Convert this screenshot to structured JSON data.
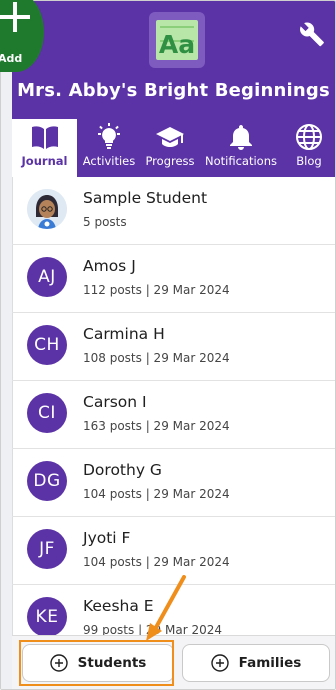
{
  "header": {
    "school_name": "Mrs. Abby's Bright Beginnings",
    "logo_text": "Aa",
    "add_label": "Add"
  },
  "tabs": [
    {
      "label": "Journal",
      "icon": "book-icon",
      "active": true
    },
    {
      "label": "Activities",
      "icon": "lightbulb-icon",
      "active": false
    },
    {
      "label": "Progress",
      "icon": "graduation-cap-icon",
      "active": false
    },
    {
      "label": "Notifications",
      "icon": "bell-icon",
      "active": false
    },
    {
      "label": "Blog",
      "icon": "globe-icon",
      "active": false
    }
  ],
  "students": [
    {
      "name": "Sample Student",
      "initials": "",
      "meta": "5 posts"
    },
    {
      "name": "Amos J",
      "initials": "AJ",
      "meta": "112 posts | 29 Mar 2024"
    },
    {
      "name": "Carmina H",
      "initials": "CH",
      "meta": "108 posts | 29 Mar 2024"
    },
    {
      "name": "Carson I",
      "initials": "CI",
      "meta": "163 posts | 29 Mar 2024"
    },
    {
      "name": "Dorothy G",
      "initials": "DG",
      "meta": "104 posts | 29 Mar 2024"
    },
    {
      "name": "Jyoti F",
      "initials": "JF",
      "meta": "104 posts | 29 Mar 2024"
    },
    {
      "name": "Keesha E",
      "initials": "KE",
      "meta": "99 posts | 29 Mar 2024"
    }
  ],
  "bottom_bar": {
    "students_label": "Students",
    "families_label": "Families"
  },
  "colors": {
    "brand_purple": "#5b33a6",
    "add_green": "#1f7a2d",
    "highlight_orange": "#f08e1c"
  }
}
